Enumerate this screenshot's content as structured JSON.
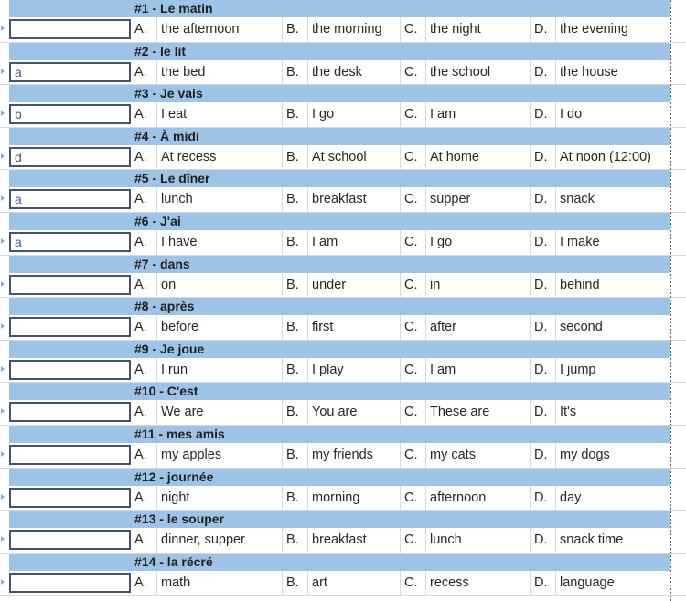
{
  "worksheet": {
    "questions": [
      {
        "title": "#1 - Le matin",
        "answer": "",
        "options": {
          "A": "the afternoon",
          "B": "the morning",
          "C": "the night",
          "D": "the evening"
        }
      },
      {
        "title": "#2 - le lit",
        "answer": "a",
        "options": {
          "A": "the bed",
          "B": "the desk",
          "C": "the school",
          "D": "the house"
        }
      },
      {
        "title": "#3 - Je vais",
        "answer": "b",
        "options": {
          "A": "I eat",
          "B": "I go",
          "C": "I am",
          "D": "I do"
        }
      },
      {
        "title": "#4 - À midi",
        "answer": "d",
        "options": {
          "A": "At recess",
          "B": "At school",
          "C": "At home",
          "D": "At noon (12:00)"
        }
      },
      {
        "title": "#5 - Le dîner",
        "answer": "a",
        "options": {
          "A": "lunch",
          "B": "breakfast",
          "C": "supper",
          "D": "snack"
        }
      },
      {
        "title": "#6 - J'ai",
        "answer": "a",
        "options": {
          "A": "I have",
          "B": "I am",
          "C": "I go",
          "D": "I make"
        }
      },
      {
        "title": "#7 - dans",
        "answer": "",
        "options": {
          "A": "on",
          "B": "under",
          "C": "in",
          "D": "behind"
        }
      },
      {
        "title": "#8 - après",
        "answer": "",
        "options": {
          "A": "before",
          "B": "first",
          "C": "after",
          "D": "second"
        }
      },
      {
        "title": "#9 - Je joue",
        "answer": "",
        "options": {
          "A": "I run",
          "B": "I play",
          "C": "I am",
          "D": "I jump"
        }
      },
      {
        "title": "#10 - C'est",
        "answer": "",
        "options": {
          "A": "We are",
          "B": "You are",
          "C": "These are",
          "D": "It's"
        }
      },
      {
        "title": "#11 - mes amis",
        "answer": "",
        "options": {
          "A": "my apples",
          "B": "my friends",
          "C": "my cats",
          "D": "my dogs"
        }
      },
      {
        "title": "#12 - journée",
        "answer": "",
        "options": {
          "A": "night",
          "B": "morning",
          "C": "afternoon",
          "D": "day"
        }
      },
      {
        "title": "#13 - le souper",
        "answer": "",
        "options": {
          "A": "dinner, supper",
          "B": "breakfast",
          "C": "lunch",
          "D": "snack time"
        }
      },
      {
        "title": "#14 - la récré",
        "answer": "",
        "options": {
          "A": "math",
          "B": "art",
          "C": "recess",
          "D": "language"
        }
      }
    ],
    "option_labels": {
      "A": "A.",
      "B": "B.",
      "C": "C.",
      "D": "D."
    }
  },
  "colors": {
    "header_fill": "#9dc3e6",
    "answer_border": "#44546a",
    "answer_text": "#3c5a8a",
    "gridline": "#d9d9d9"
  }
}
